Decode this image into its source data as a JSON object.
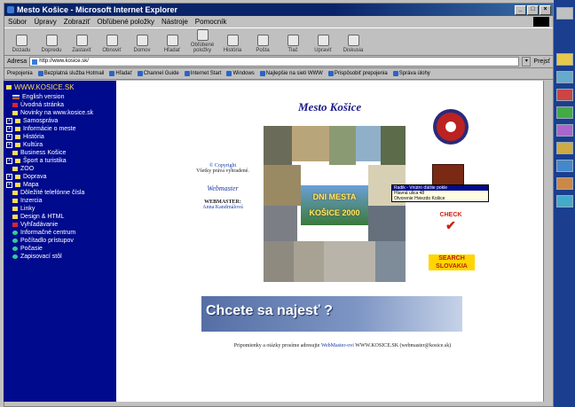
{
  "window": {
    "title": "Mesto Košice - Microsoft Internet Explorer",
    "controls": [
      "_",
      "□",
      "×"
    ]
  },
  "menu": [
    "Súbor",
    "Úpravy",
    "Zobraziť",
    "Obľúbené položky",
    "Nástroje",
    "Pomocník"
  ],
  "toolbar": [
    "Dozadu",
    "Dopredu",
    "Zastaviť",
    "Obnoviť",
    "Domov",
    "Hľadať",
    "Obľúbené položky",
    "História",
    "Pošta",
    "Tlač",
    "Upraviť",
    "Diskusia"
  ],
  "address": {
    "label": "Adresa",
    "value": "http://www.kosice.sk/",
    "go_label": "Prejsť"
  },
  "links": {
    "label": "Prepojenia",
    "items": [
      "Bezplatná služba Hotmail",
      "Hľadať",
      "Channel Guide",
      "Internet Start",
      "Windows",
      "Najlepšie na sieti WWW",
      "Prispôsobiť prepojenia",
      "Správa úlohy"
    ]
  },
  "sidebar": {
    "header": "WWW.KOSICE.SK",
    "items": [
      {
        "label": "English version",
        "icon": "flag-icon",
        "sub": true
      },
      {
        "label": "Úvodná stránka",
        "icon": "home-icon",
        "sub": true
      },
      {
        "label": "Novinky na www.kosice.sk",
        "icon": "folder-icon",
        "sub": true
      },
      {
        "label": "Samospráva",
        "icon": "folder-icon",
        "sub": false
      },
      {
        "label": "Informácie o meste",
        "icon": "folder-icon",
        "sub": false
      },
      {
        "label": "História",
        "icon": "folder-icon",
        "sub": false
      },
      {
        "label": "Kultúra",
        "icon": "folder-icon",
        "sub": false
      },
      {
        "label": "Business Košice",
        "icon": "folder-icon",
        "sub": true
      },
      {
        "label": "Šport a turistika",
        "icon": "folder-icon",
        "sub": false
      },
      {
        "label": "ZOO",
        "icon": "folder-icon",
        "sub": true
      },
      {
        "label": "Doprava",
        "icon": "folder-icon",
        "sub": false
      },
      {
        "label": "Mapa",
        "icon": "folder-icon",
        "sub": false
      },
      {
        "label": "Dôležité telefónne čísla",
        "icon": "folder-icon",
        "sub": true
      },
      {
        "label": "Inzercia",
        "icon": "folder-icon",
        "sub": true
      },
      {
        "label": "Linky",
        "icon": "folder-icon",
        "sub": true
      },
      {
        "label": "Design & HTML",
        "icon": "folder-icon",
        "sub": true
      },
      {
        "label": "Vyhľadávanie",
        "icon": "dot-icon",
        "sub": true
      },
      {
        "label": "Informačné centrum",
        "icon": "info-icon",
        "sub": true
      },
      {
        "label": "Počítadlo prístupov",
        "icon": "globe-icon",
        "sub": true
      },
      {
        "label": "Počasie",
        "icon": "globe-icon",
        "sub": true
      },
      {
        "label": "Zapisovací stôl",
        "icon": "globe-icon",
        "sub": true
      }
    ]
  },
  "main": {
    "title": "Mesto Košice",
    "banner_line1": "DNI MESTA",
    "banner_line2": "KOŠICE 2000",
    "copyright": "© Copyright",
    "rights": "Všetky práva vyhradené.",
    "webmaster_logo": "Webmaster",
    "webmaster_label": "WEBMASTER:",
    "webmaster_name": "Anna Kandrnálová",
    "tooltip": {
      "header": "Radik - Vnútro ďalšie pokle",
      "line1": "Hlavná ulica 48",
      "line2": "Otvorenie Hviezdo Košice"
    },
    "check_label": "CHECK",
    "search_label": "SEARCH SLOVAKIA",
    "ad_text": "Chcete sa najesť ?",
    "footer_prefix": "Pripomienky a otázky prosíme adresujte",
    "footer_link": "WebMaster-ovi",
    "footer_suffix": "WWW.KOSICE.SK (webmaster@kosice.sk)"
  },
  "colors": {
    "sidebar_bg": "#000a8c",
    "title_blue": "#1a1a8a",
    "titlebar": "#0a246a"
  }
}
